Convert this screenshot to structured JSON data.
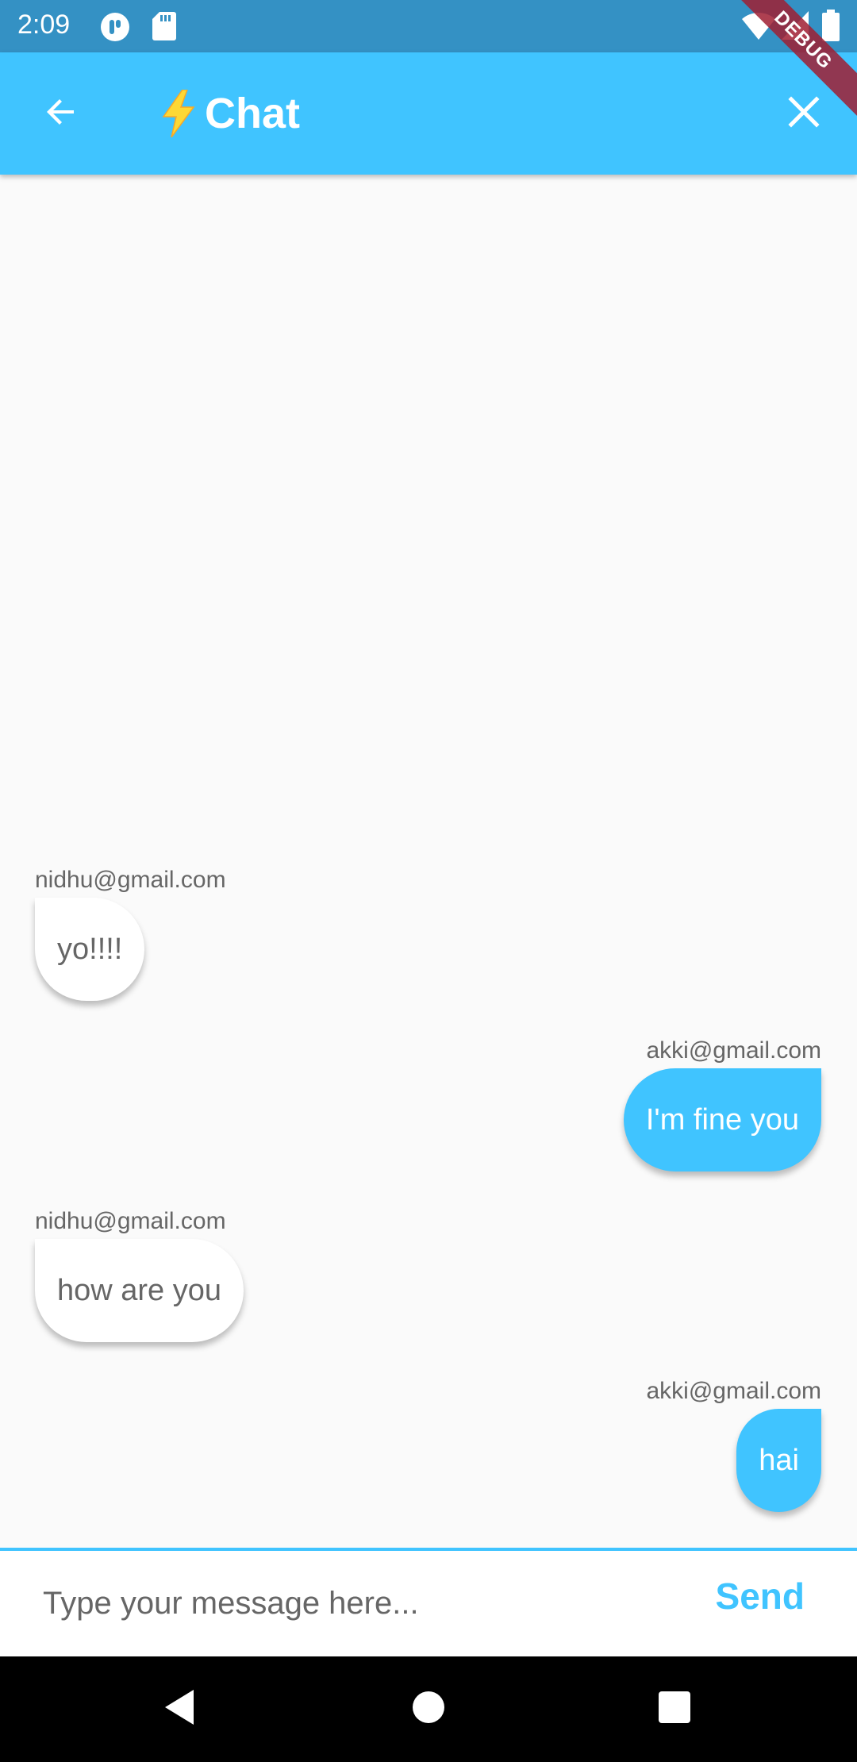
{
  "status_bar": {
    "time": "2:09",
    "icons": [
      "app-notification-icon",
      "sd-card-icon",
      "wifi-icon",
      "signal-icon",
      "battery-icon"
    ]
  },
  "app_bar": {
    "back_icon": "arrow-left-icon",
    "title_icon": "lightning-bolt-icon",
    "title": "Chat",
    "close_icon": "close-icon",
    "background_color": "#40c4ff"
  },
  "debug_banner": "DEBUG",
  "messages": [
    {
      "sender": "nidhu@gmail.com",
      "text": "yo!!!!",
      "side": "left"
    },
    {
      "sender": "akki@gmail.com",
      "text": "I'm fine you",
      "side": "right"
    },
    {
      "sender": "nidhu@gmail.com",
      "text": "how are you",
      "side": "left"
    },
    {
      "sender": "akki@gmail.com",
      "text": "hai",
      "side": "right"
    }
  ],
  "composer": {
    "placeholder": "Type your message here...",
    "value": "",
    "send_label": "Send"
  },
  "colors": {
    "accent": "#40c4ff",
    "status_bar": "#3491c4",
    "incoming_bubble": "#ffffff",
    "outgoing_bubble": "#40c4ff"
  },
  "nav_bar": {
    "icons": [
      "back-triangle-icon",
      "home-circle-icon",
      "recents-square-icon"
    ]
  }
}
